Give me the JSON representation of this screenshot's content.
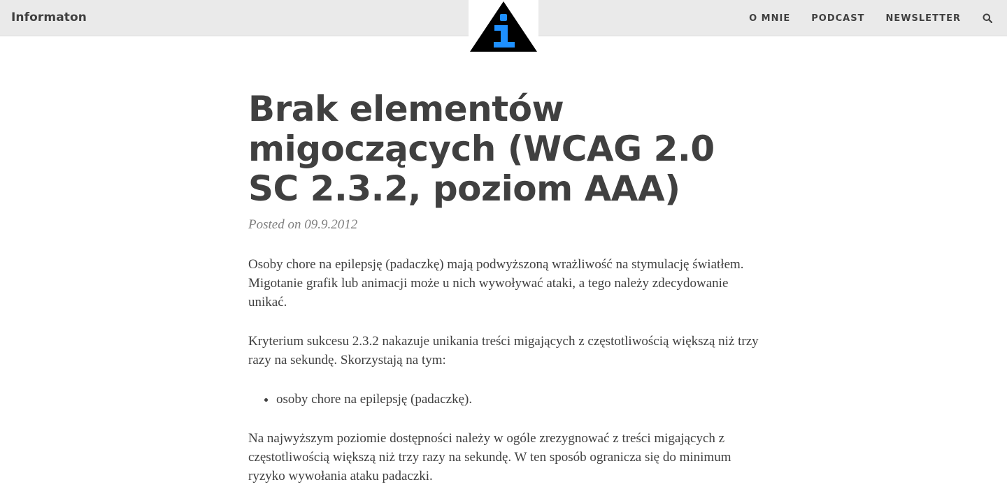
{
  "nav": {
    "brand": "Informaton",
    "links": [
      "O MNIE",
      "PODCAST",
      "NEWSLETTER"
    ],
    "search_icon": "search-icon"
  },
  "logo": {
    "icon": "info-triangle-icon",
    "colors": {
      "triangle": "#000000",
      "glyph": "#1e90ff"
    }
  },
  "post": {
    "title": "Brak elementów migoczących (WCAG 2.0 SC 2.3.2, poziom AAA)",
    "meta": "Posted on 09.9.2012",
    "paragraphs": [
      "Osoby chore na epilepsję (padaczkę) mają podwyższoną wrażliwość na stymulację światłem. Migotanie grafik lub animacji może u nich wywoływać ataki, a tego należy zdecydowanie unikać.",
      "Kryterium sukcesu 2.3.2 nakazuje unikania treści migających z częstotliwością większą niż trzy razy na sekundę. Skorzystają na tym:",
      "Na najwyższym poziomie dostępności należy w ogóle zrezygnować z treści migających z częstotliwością większą niż trzy razy na sekundę. W ten sposób ogranicza się do minimum ryzyko wywołania ataku padaczki."
    ],
    "list": [
      "osoby chore na epilepsję (padaczkę)."
    ]
  }
}
